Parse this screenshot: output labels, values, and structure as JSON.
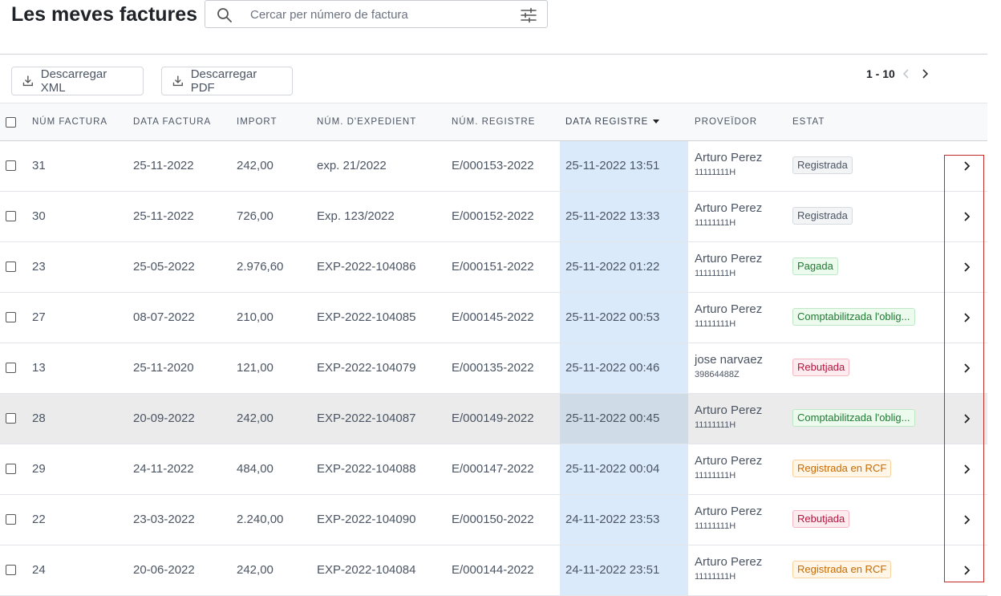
{
  "page": {
    "title": "Les meves factures"
  },
  "search": {
    "placeholder": "Cercar per número de factura",
    "value": ""
  },
  "toolbar": {
    "download_xml": "Descarregar XML",
    "download_pdf": "Descarregar PDF"
  },
  "pagination": {
    "range": "1 - 10"
  },
  "table": {
    "headers": {
      "num_factura": "NÚM FACTURA",
      "data_factura": "DATA FACTURA",
      "import": "IMPORT",
      "num_expedient": "NÚM. D'EXPEDIENT",
      "num_registre": "NÚM. REGISTRE",
      "data_registre": "DATA REGISTRE",
      "proveidor": "PROVEÏDOR",
      "estat": "ESTAT"
    },
    "sorted_by": "data_registre",
    "rows": [
      {
        "num": "31",
        "data_factura": "25-11-2022",
        "import": "242,00",
        "expedient": "exp. 21/2022",
        "registre": "E/000153-2022",
        "data_registre": "25-11-2022 13:51",
        "proveidor": "Arturo Perez",
        "nif": "11111111H",
        "estat": "Registrada",
        "estat_color": "gray"
      },
      {
        "num": "30",
        "data_factura": "25-11-2022",
        "import": "726,00",
        "expedient": "Exp. 123/2022",
        "registre": "E/000152-2022",
        "data_registre": "25-11-2022 13:33",
        "proveidor": "Arturo Perez",
        "nif": "11111111H",
        "estat": "Registrada",
        "estat_color": "gray"
      },
      {
        "num": "23",
        "data_factura": "25-05-2022",
        "import": "2.976,60",
        "expedient": "EXP-2022-104086",
        "registre": "E/000151-2022",
        "data_registre": "25-11-2022 01:22",
        "proveidor": "Arturo Perez",
        "nif": "11111111H",
        "estat": "Pagada",
        "estat_color": "green"
      },
      {
        "num": "27",
        "data_factura": "08-07-2022",
        "import": "210,00",
        "expedient": "EXP-2022-104085",
        "registre": "E/000145-2022",
        "data_registre": "25-11-2022 00:53",
        "proveidor": "Arturo Perez",
        "nif": "11111111H",
        "estat": "Comptabilitzada l'oblig...",
        "estat_color": "green"
      },
      {
        "num": "13",
        "data_factura": "25-11-2020",
        "import": "121,00",
        "expedient": "EXP-2022-104079",
        "registre": "E/000135-2022",
        "data_registre": "25-11-2022 00:46",
        "proveidor": "jose narvaez",
        "nif": "39864488Z",
        "estat": "Rebutjada",
        "estat_color": "red"
      },
      {
        "num": "28",
        "data_factura": "20-09-2022",
        "import": "242,00",
        "expedient": "EXP-2022-104087",
        "registre": "E/000149-2022",
        "data_registre": "25-11-2022 00:45",
        "proveidor": "Arturo Perez",
        "nif": "11111111H",
        "estat": "Comptabilitzada l'oblig...",
        "estat_color": "green",
        "hover": true
      },
      {
        "num": "29",
        "data_factura": "24-11-2022",
        "import": "484,00",
        "expedient": "EXP-2022-104088",
        "registre": "E/000147-2022",
        "data_registre": "25-11-2022 00:04",
        "proveidor": "Arturo Perez",
        "nif": "11111111H",
        "estat": "Registrada en RCF",
        "estat_color": "orange"
      },
      {
        "num": "22",
        "data_factura": "23-03-2022",
        "import": "2.240,00",
        "expedient": "EXP-2022-104090",
        "registre": "E/000150-2022",
        "data_registre": "24-11-2022 23:53",
        "proveidor": "Arturo Perez",
        "nif": "11111111H",
        "estat": "Rebutjada",
        "estat_color": "red"
      },
      {
        "num": "24",
        "data_factura": "20-06-2022",
        "import": "242,00",
        "expedient": "EXP-2022-104084",
        "registre": "E/000144-2022",
        "data_registre": "24-11-2022 23:51",
        "proveidor": "Arturo Perez",
        "nif": "11111111H",
        "estat": "Registrada en RCF",
        "estat_color": "orange"
      }
    ]
  },
  "colors": {
    "sorted_column": "#dbeafa",
    "highlight_box": "#c62828"
  }
}
